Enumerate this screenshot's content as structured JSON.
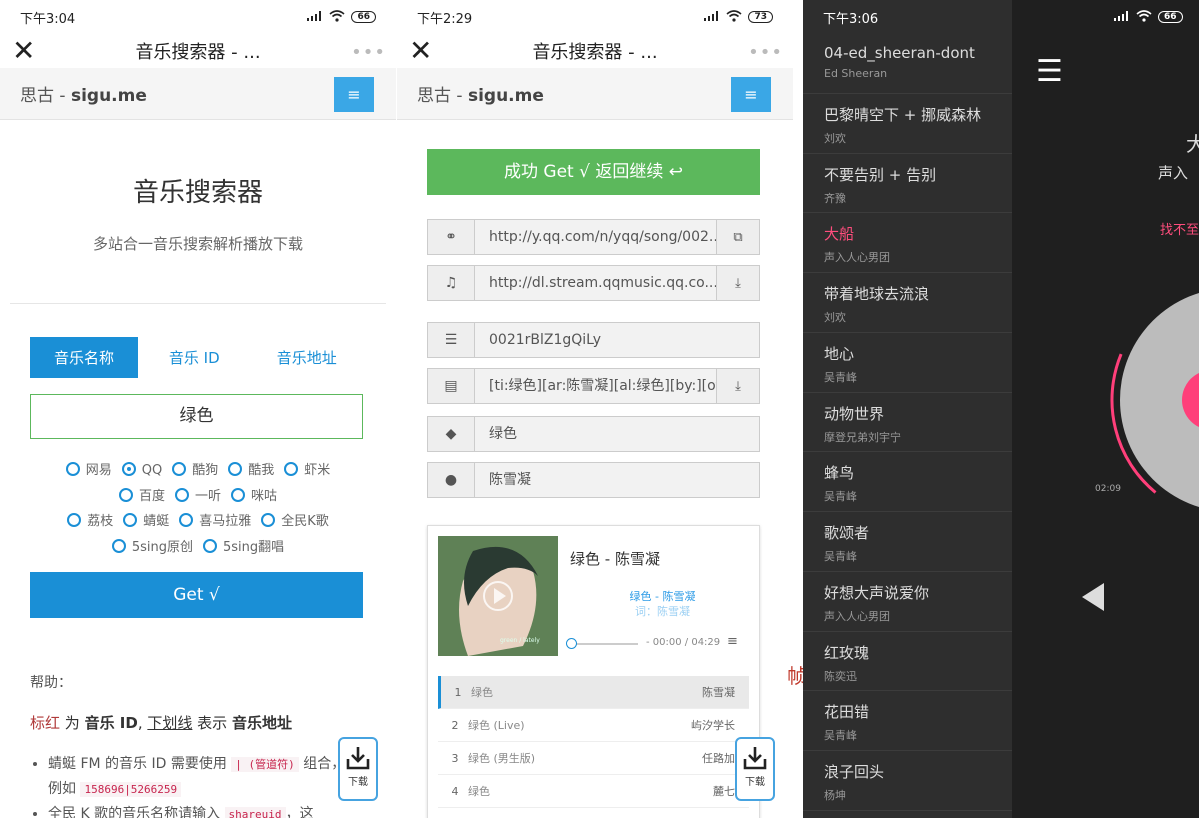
{
  "panel1": {
    "status": {
      "time": "下午3:04",
      "signal": "::ıll",
      "battery": "66"
    },
    "title": "音乐搜索器 - ...",
    "site": {
      "brand_a": "思古 - ",
      "brand_b": "sigu.me"
    },
    "hero": {
      "title": "音乐搜索器",
      "subtitle": "多站合一音乐搜索解析播放下载"
    },
    "tabs": [
      "音乐名称",
      "音乐 ID",
      "音乐地址"
    ],
    "search_value": "绿色",
    "sources": [
      {
        "label": "网易",
        "checked": false
      },
      {
        "label": "QQ",
        "checked": true
      },
      {
        "label": "酷狗",
        "checked": false
      },
      {
        "label": "酷我",
        "checked": false
      },
      {
        "label": "虾米",
        "checked": false
      },
      {
        "label": "百度",
        "checked": false
      },
      {
        "label": "一听",
        "checked": false
      },
      {
        "label": "咪咕",
        "checked": false
      },
      {
        "label": "荔枝",
        "checked": false
      },
      {
        "label": "蜻蜓",
        "checked": false
      },
      {
        "label": "喜马拉雅",
        "checked": false
      },
      {
        "label": "全民K歌",
        "checked": false
      },
      {
        "label": "5sing原创",
        "checked": false
      },
      {
        "label": "5sing翻唱",
        "checked": false
      }
    ],
    "get_label": "Get √",
    "help": {
      "title": "帮助：",
      "red_word": "标红",
      "t1": " 为 ",
      "id_word": "音乐 ID",
      "comma": ", ",
      "underline_word": "下划线",
      "t2": " 表示 ",
      "addr_word": "音乐地址",
      "b1_a": "蜻蜓 FM 的音乐 ID 需要使用 ",
      "b1_code1": "| (管道符)",
      "b1_b": " 组合，例如 ",
      "b1_code2": "158696|5266259",
      "b2_a": "全民 K 歌的音乐名称请输入 ",
      "b2_code": "shareuid",
      "b2_b": "，这"
    },
    "download_label": "下载"
  },
  "panel2": {
    "status": {
      "time": "下午2:29",
      "battery": "73"
    },
    "title": "音乐搜索器 - ...",
    "site": {
      "brand_a": "思古 - ",
      "brand_b": "sigu.me"
    },
    "ok_label": "成功 Get √ 返回继续 ↩",
    "fields": {
      "link": "http://y.qq.com/n/yqq/song/002...",
      "url": "http://dl.stream.qqmusic.qq.co...",
      "id": "0021rBlZ1gQiLy",
      "lrc": "[ti:绿色][ar:陈雪凝][al:绿色][by:][of...",
      "name": "绿色",
      "artist": "陈雪凝"
    },
    "player": {
      "title": "绿色 - 陈雪凝",
      "lrc_line1": "绿色 - 陈雪凝",
      "lrc_line2": "词：陈雪凝",
      "time": "- 00:00 / 04:29",
      "progress": 0,
      "cover_text": "green / lately"
    },
    "playlist": [
      {
        "idx": "1",
        "name": "绿色",
        "artist": "陈雪凝"
      },
      {
        "idx": "2",
        "name": "绿色 (Live)",
        "artist": "屿汐学长"
      },
      {
        "idx": "3",
        "name": "绿色 (男生版)",
        "artist": "任路加"
      },
      {
        "idx": "4",
        "name": "绿色",
        "artist": "麓七"
      }
    ],
    "download_label": "下载"
  },
  "panel3": {
    "status": {
      "time": "下午3:06",
      "battery": "66"
    },
    "songs": [
      {
        "title": "04-ed_sheeran-dont",
        "artist": "Ed Sheeran"
      },
      {
        "title": "巴黎晴空下 + 挪威森林",
        "artist": "刘欢"
      },
      {
        "title": "不要告别 + 告别",
        "artist": "齐豫"
      },
      {
        "title": "大船",
        "artist": "声入人心男团",
        "active": true
      },
      {
        "title": "带着地球去流浪",
        "artist": "刘欢"
      },
      {
        "title": "地心",
        "artist": "吴青峰"
      },
      {
        "title": "动物世界",
        "artist": "摩登兄弟刘宇宁"
      },
      {
        "title": "蜂鸟",
        "artist": "吴青峰"
      },
      {
        "title": "歌颂者",
        "artist": "吴青峰"
      },
      {
        "title": "好想大声说爱你",
        "artist": "声入人心男团"
      },
      {
        "title": "红玫瑰",
        "artist": "陈奕迅"
      },
      {
        "title": "花田错",
        "artist": "吴青峰"
      },
      {
        "title": "浪子回头",
        "artist": "杨坤"
      }
    ],
    "cut_title": "大",
    "cut_artist": "声入",
    "cut_lyric": "找不至",
    "elapsed": "02:09",
    "progress_fraction": 0.45
  },
  "misc": {
    "cut_char": "帧"
  },
  "colors": {
    "primary": "#1a8fd6",
    "success": "#5cb85c",
    "accent_pink": "#ff4d7d"
  }
}
